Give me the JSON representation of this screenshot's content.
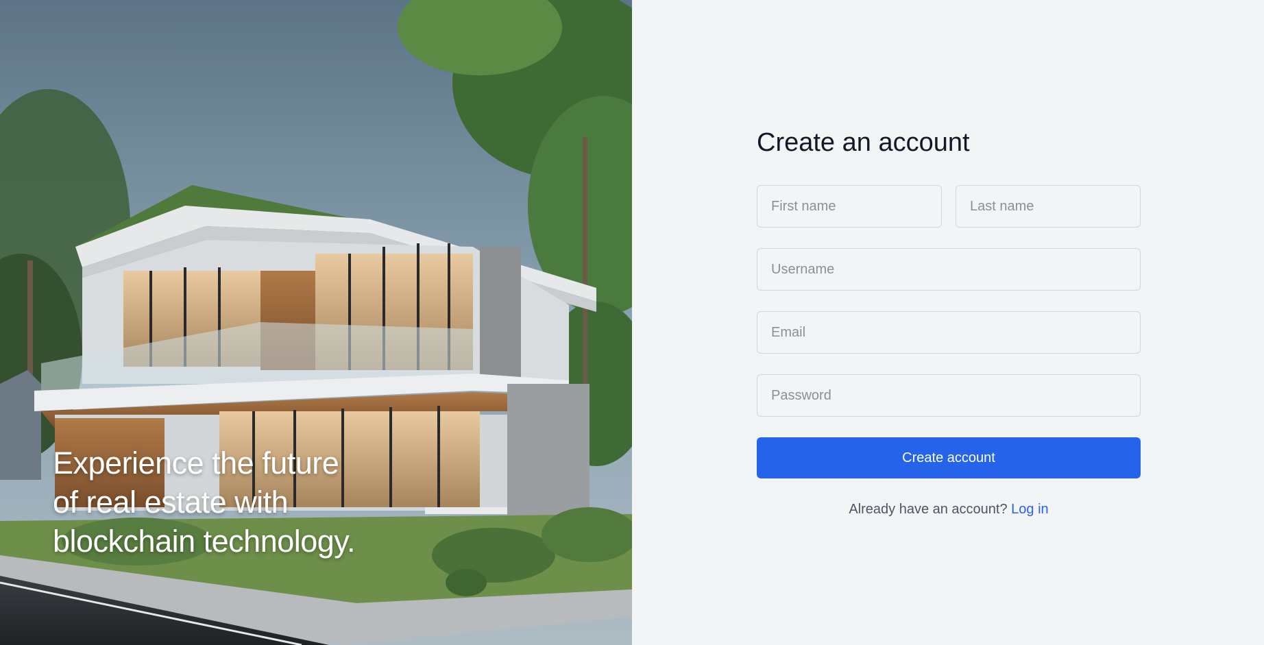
{
  "hero": {
    "tagline_lines": [
      "Experience the future",
      "of real estate with",
      "blockchain technology."
    ]
  },
  "form": {
    "title": "Create an account",
    "first_name_placeholder": "First name",
    "last_name_placeholder": "Last name",
    "username_placeholder": "Username",
    "email_placeholder": "Email",
    "password_placeholder": "Password",
    "submit_label": "Create account",
    "footer_text": "Already have an account?",
    "login_link": "Log in"
  },
  "colors": {
    "accent": "#2563eb",
    "panel_background": "#f3f4f6",
    "title_text": "#111827"
  }
}
